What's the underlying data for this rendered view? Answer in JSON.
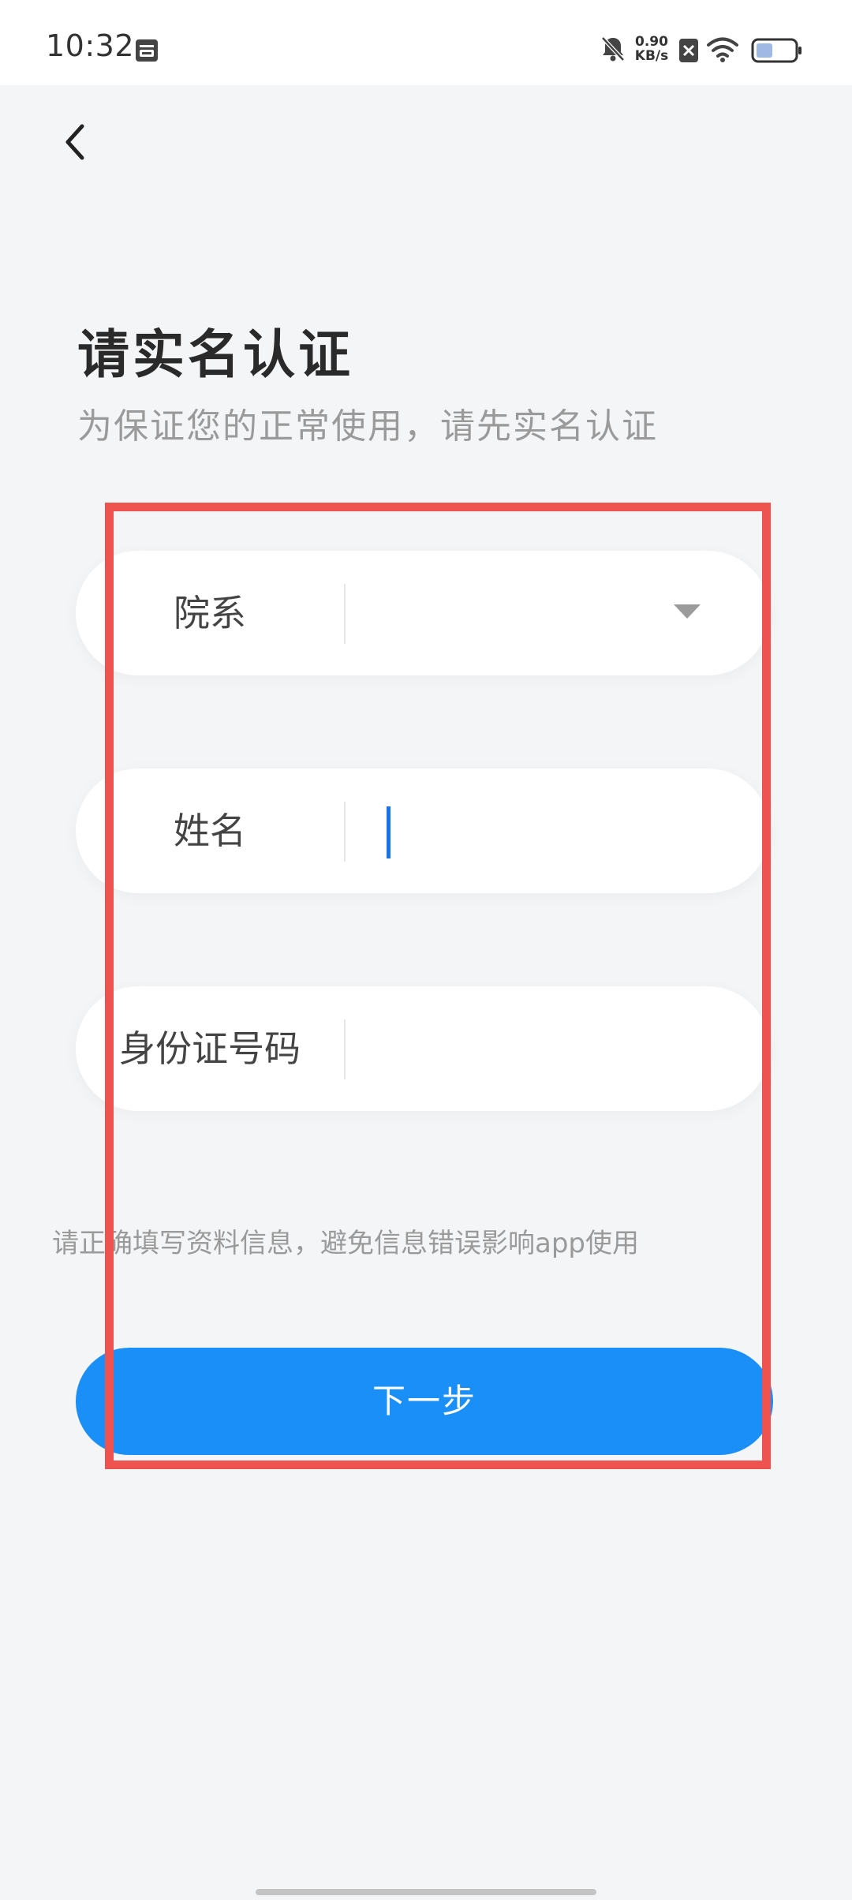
{
  "status_bar": {
    "time": "10:32",
    "net_speed_value": "0.90",
    "net_speed_unit": "KB/s",
    "icons": [
      "calendar-icon",
      "bell-off-icon",
      "sim-off-icon",
      "wifi-icon",
      "battery-icon"
    ]
  },
  "header": {
    "back_icon": "chevron-left-icon"
  },
  "page": {
    "title": "请实名认证",
    "subtitle": "为保证您的正常使用，请先实名认证"
  },
  "form": {
    "fields": [
      {
        "label": "院系",
        "value": "",
        "type": "select"
      },
      {
        "label": "姓名",
        "value": "",
        "type": "text"
      },
      {
        "label": "身份证号码",
        "value": "",
        "type": "text"
      }
    ],
    "hint": "请正确填写资料信息，避免信息错误影响app使用",
    "submit_label": "下一步"
  },
  "colors": {
    "accent": "#1a8ff7",
    "highlight": "#ef5350",
    "background": "#f4f5f7"
  }
}
